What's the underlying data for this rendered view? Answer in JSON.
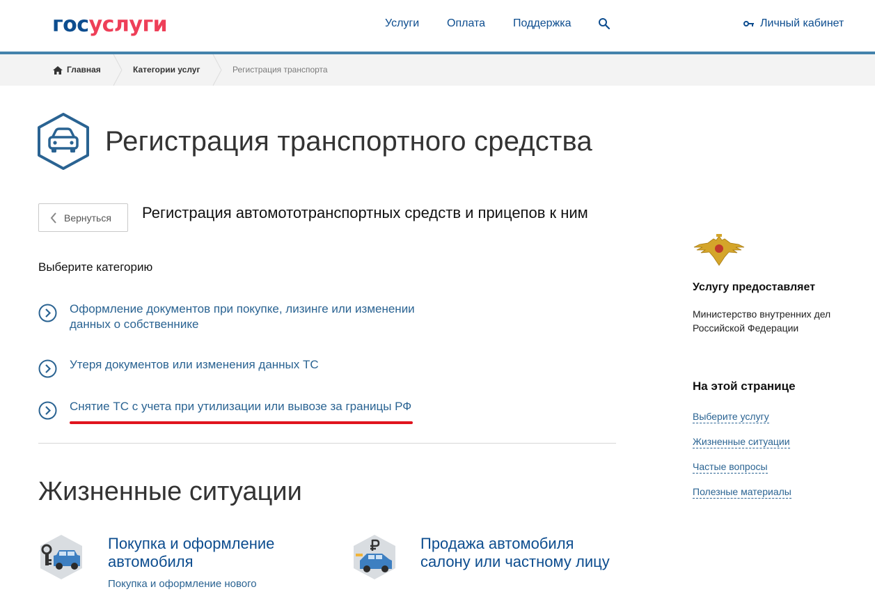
{
  "header": {
    "logo_part1": "гос",
    "logo_part2": "услуги",
    "nav": [
      "Услуги",
      "Оплата",
      "Поддержка"
    ],
    "cabinet_label": "Личный кабинет"
  },
  "breadcrumb": {
    "home": "Главная",
    "category": "Категории услуг",
    "current": "Регистрация транспорта"
  },
  "page": {
    "title": "Регистрация транспортного средства",
    "back_label": "Вернуться",
    "subtitle": "Регистрация автомототранспортных средств и прицепов к ним",
    "choose_label": "Выберите категорию",
    "categories": [
      {
        "line1": "Оформление документов при покупке, лизинге или изменении",
        "line2": "данных о собственнике"
      },
      {
        "line1": "Утеря документов или изменения данных ТС",
        "line2": ""
      },
      {
        "line1": "Снятие ТС с учета при утилизации или вывозе за границы РФ",
        "line2": ""
      }
    ],
    "life_title": "Жизненные ситуации",
    "life_cards": [
      {
        "line1": "Покупка и оформление",
        "line2": "автомобиля",
        "sub": "Покупка и оформление нового"
      },
      {
        "line1": "Продажа автомобиля",
        "line2": "салону или частному лицу"
      }
    ]
  },
  "sidebar": {
    "provider_heading": "Услугу предоставляет",
    "provider_line1": "Министерство внутренних дел",
    "provider_line2": "Российской Федерации",
    "onpage_heading": "На этой странице",
    "onpage_links": [
      "Выберите услугу",
      "Жизненные ситуации",
      "Частые вопросы",
      "Полезные материалы"
    ]
  },
  "colors": {
    "brand_blue": "#0d4d8f",
    "brand_red": "#ee3f58",
    "link_blue": "#2a6392",
    "header_line": "#4482ab",
    "highlight_red": "#e0141e"
  }
}
